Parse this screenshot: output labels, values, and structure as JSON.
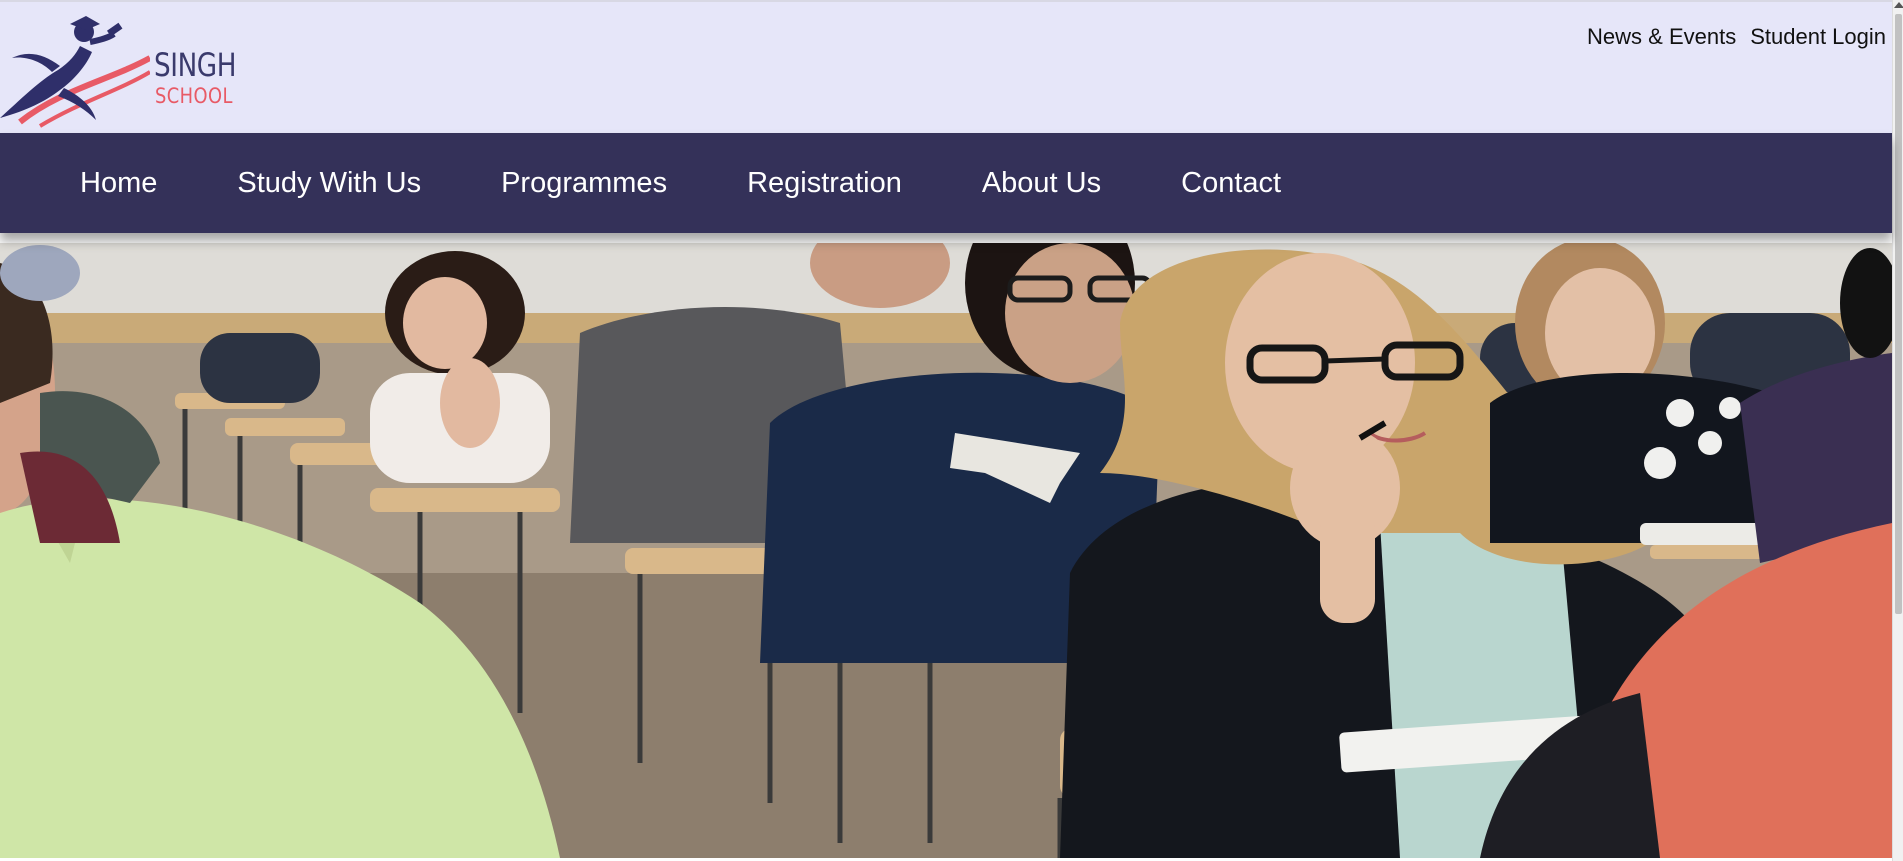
{
  "logo": {
    "line1": "SINGH",
    "line2": "SCHOOL",
    "icon": "graduate-runner-logo"
  },
  "top_links": {
    "news": "News & Events",
    "login": "Student Login"
  },
  "nav": {
    "items": [
      "Home",
      "Study With Us",
      "Programmes",
      "Registration",
      "About Us",
      "Contact"
    ]
  },
  "hero": {
    "alt": "students-in-classroom-image"
  },
  "colors": {
    "header_bg": "#e6e6f9",
    "nav_bg": "#343159",
    "logo_navy": "#2f2f6a",
    "logo_red": "#e85a66"
  }
}
